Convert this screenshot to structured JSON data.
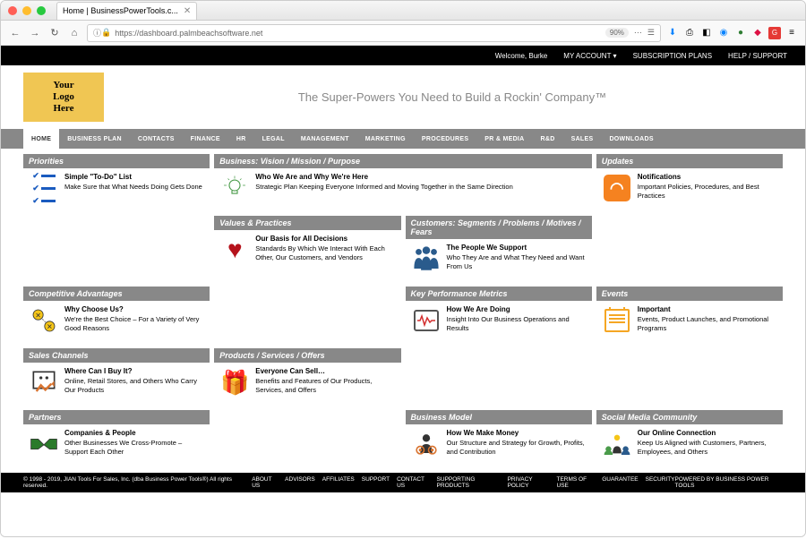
{
  "browser": {
    "tab_title": "Home | BusinessPowerTools.c...",
    "url": "https://dashboard.palmbeachsoftware.net",
    "zoom": "90%"
  },
  "topbar": {
    "welcome": "Welcome, Burke",
    "my_account": "MY ACCOUNT ▾",
    "plans": "SUBSCRIPTION PLANS",
    "help": "HELP / SUPPORT"
  },
  "header": {
    "logo": "Your\nLogo\nHere",
    "tagline": "The Super-Powers You Need to Build a Rockin' Company™"
  },
  "nav": [
    "HOME",
    "BUSINESS PLAN",
    "CONTACTS",
    "FINANCE",
    "HR",
    "LEGAL",
    "MANAGEMENT",
    "MARKETING",
    "PROCEDURES",
    "PR & MEDIA",
    "R&D",
    "SALES",
    "DOWNLOADS"
  ],
  "cards": {
    "priorities": {
      "h": "Priorities",
      "t": "Simple \"To-Do\" List",
      "d": "Make Sure that What Needs Doing Gets Done"
    },
    "vision": {
      "h": "Business: Vision / Mission / Purpose",
      "t": "Who We Are and Why We're Here",
      "d": "Strategic Plan Keeping Everyone Informed and Moving Together in the Same Direction"
    },
    "updates": {
      "h": "Updates",
      "t": "Notifications",
      "d": "Important Policies, Procedures, and Best Practices"
    },
    "values": {
      "h": "Values & Practices",
      "t": "Our Basis for All Decisions",
      "d": "Standards By Which We Interact With Each Other, Our Customers, and Vendors"
    },
    "customers": {
      "h": "Customers: Segments / Problems / Motives / Fears",
      "t": "The People We Support",
      "d": "Who They Are and What They Need and Want From Us"
    },
    "comp": {
      "h": "Competitive Advantages",
      "t": "Why Choose Us?",
      "d": "We're the Best Choice – For a Variety of Very Good Reasons"
    },
    "kpi": {
      "h": "Key Performance Metrics",
      "t": "How We Are Doing",
      "d": "Insight Into Our Business Operations and Results"
    },
    "events": {
      "h": "Events",
      "t": "Important",
      "d": "Events, Product Launches, and Promotional Programs"
    },
    "sales": {
      "h": "Sales Channels",
      "t": "Where Can I Buy It?",
      "d": "Online, Retail Stores, and Others Who Carry Our Products"
    },
    "products": {
      "h": "Products / Services / Offers",
      "t": "Everyone Can Sell…",
      "d": "Benefits and Features of Our Products, Services, and Offers"
    },
    "partners": {
      "h": "Partners",
      "t": "Companies & People",
      "d": "Other Businesses We Cross-Promote – Support Each Other"
    },
    "bizmodel": {
      "h": "Business Model",
      "t": "How We Make Money",
      "d": "Our Structure and Strategy for Growth, Profits, and Contribution"
    },
    "social": {
      "h": "Social Media Community",
      "t": "Our Online Connection",
      "d": "Keep Us Aligned with Customers, Partners, Employees, and Others"
    }
  },
  "footer": {
    "copyright": "© 1998 - 2019, JIAN Tools For Sales, Inc. (dba Business Power Tools®) All rights reserved.",
    "links": [
      "ABOUT US",
      "ADVISORS",
      "AFFILIATES",
      "SUPPORT",
      "CONTACT US",
      "SUPPORTING PRODUCTS",
      "PRIVACY POLICY",
      "TERMS OF USE",
      "GUARANTEE",
      "SECURITY"
    ],
    "powered": "POWERED BY BUSINESS POWER TOOLS"
  }
}
